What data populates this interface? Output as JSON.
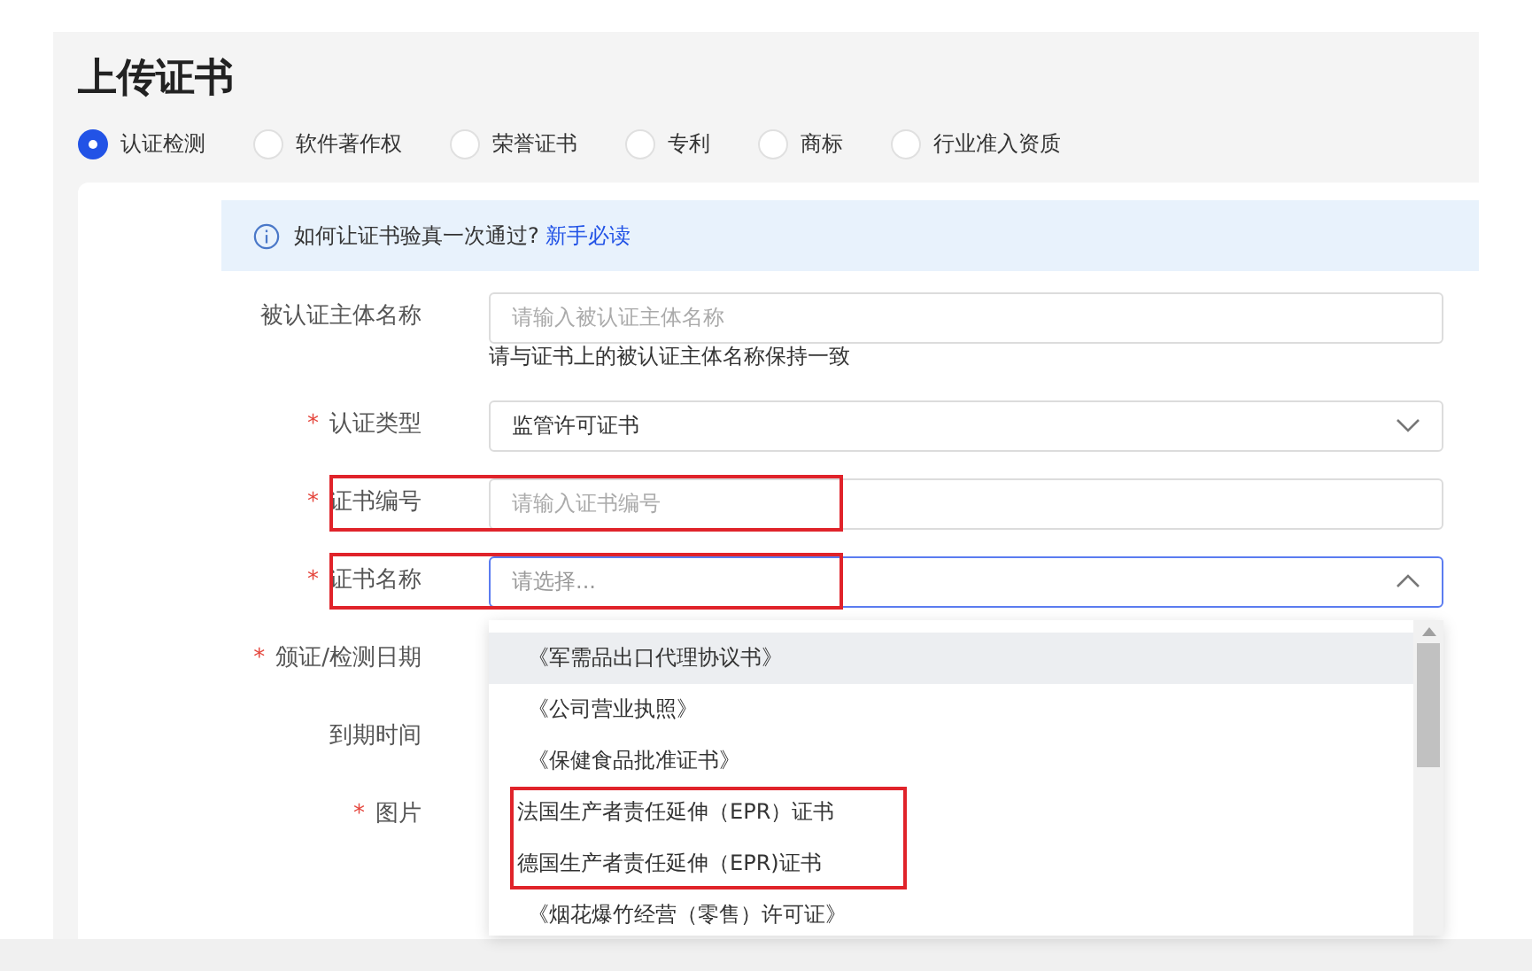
{
  "title": "上传证书",
  "categories": [
    {
      "label": "认证检测",
      "selected": true
    },
    {
      "label": "软件著作权",
      "selected": false
    },
    {
      "label": "荣誉证书",
      "selected": false
    },
    {
      "label": "专利",
      "selected": false
    },
    {
      "label": "商标",
      "selected": false
    },
    {
      "label": "行业准入资质",
      "selected": false
    }
  ],
  "notice": {
    "text": "如何让证书验真一次通过?",
    "link": "新手必读"
  },
  "fields": [
    {
      "kind": "input",
      "label": "被认证主体名称",
      "placeholder": "请输入被认证主体名称",
      "hint": "请与证书上的被认证主体名称保持一致",
      "highlighted": false
    },
    {
      "kind": "select",
      "label": "认证类型",
      "required_mark": "*",
      "value": "监管许可证书",
      "expanded": false,
      "highlighted": false
    },
    {
      "kind": "input",
      "label": "证书编号",
      "required_mark": "*",
      "placeholder": "请输入证书编号",
      "highlighted": true
    },
    {
      "kind": "select",
      "label": "证书名称",
      "required_mark": "*",
      "placeholder": "请选择...",
      "expanded": true,
      "highlighted": true,
      "options": [
        {
          "label": "《军需品出口代理协议书》",
          "selected": true,
          "highlighted": false
        },
        {
          "label": "《公司营业执照》",
          "selected": false,
          "highlighted": false
        },
        {
          "label": "《保健食品批准证书》",
          "selected": false,
          "highlighted": false
        },
        {
          "label": "法国生产者责任延伸（EPR）证书",
          "selected": false,
          "highlighted": true
        },
        {
          "label": "德国生产者责任延伸（EPR)证书",
          "selected": false,
          "highlighted": true
        },
        {
          "label": "《烟花爆竹经营（零售）许可证》",
          "selected": false,
          "highlighted": false
        }
      ]
    },
    {
      "kind": "hidden",
      "label": "颁证/检测日期",
      "required_mark": "*"
    },
    {
      "kind": "hidden",
      "label": "到期时间"
    },
    {
      "kind": "hidden",
      "label": "图片",
      "required_mark": "*"
    }
  ]
}
